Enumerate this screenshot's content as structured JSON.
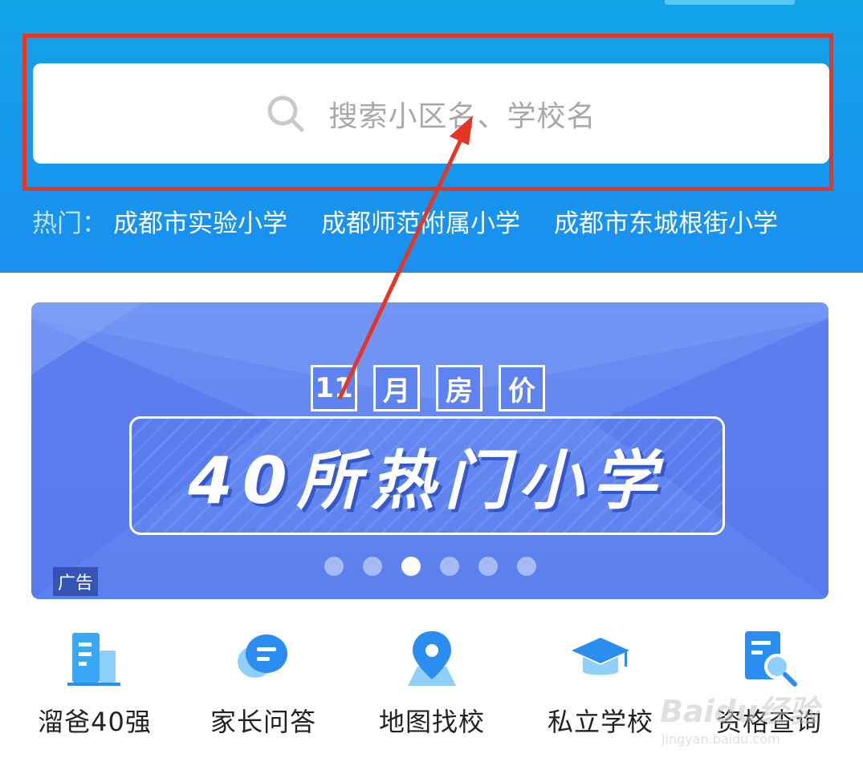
{
  "search": {
    "placeholder": "搜索小区名、学校名"
  },
  "hot": {
    "label": "热门：",
    "links": [
      "成都市实验小学",
      "成都师范附属小学",
      "成都市东城根街小学"
    ]
  },
  "banner": {
    "tags": [
      "11",
      "月",
      "房",
      "价"
    ],
    "title": "40所热门小学",
    "ad_label": "广告",
    "slide_count": 6,
    "active_slide": 3
  },
  "nav": {
    "items": [
      {
        "label": "溜爸40强",
        "icon": "building-chart-icon"
      },
      {
        "label": "家长问答",
        "icon": "chat-bubbles-icon"
      },
      {
        "label": "地图找校",
        "icon": "map-pin-icon"
      },
      {
        "label": "私立学校",
        "icon": "graduation-cap-icon"
      },
      {
        "label": "资格查询",
        "icon": "document-search-icon"
      }
    ]
  },
  "watermark": {
    "text": "Baidu经验",
    "sub": "jingyan.baidu.com"
  },
  "colors": {
    "header": "#1a9bea",
    "highlight": "#e53525",
    "banner": "#5b80ef",
    "icon": "#2b8df0"
  }
}
